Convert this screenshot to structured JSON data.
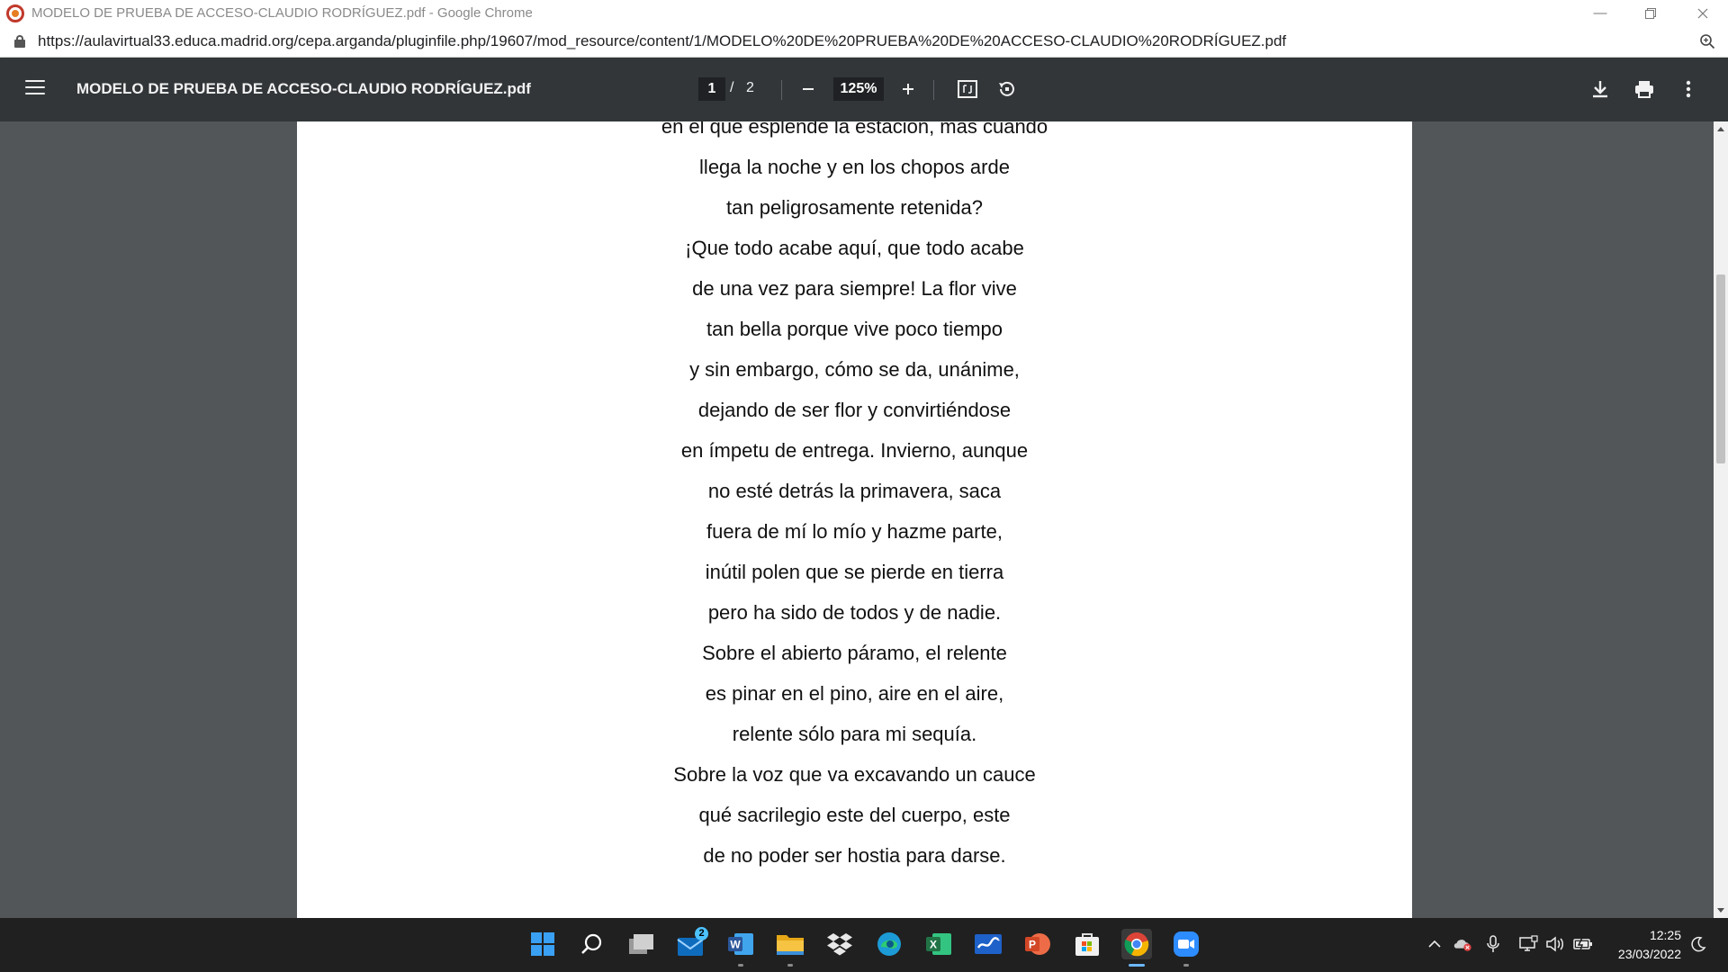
{
  "window": {
    "title": "MODELO DE PRUEBA DE ACCESO-CLAUDIO RODRÍGUEZ.pdf - Google Chrome"
  },
  "address_bar": {
    "url": "https://aulavirtual33.educa.madrid.org/cepa.arganda/pluginfile.php/19607/mod_resource/content/1/MODELO%20DE%20PRUEBA%20DE%20ACCESO-CLAUDIO%20RODRÍGUEZ.pdf"
  },
  "pdf_toolbar": {
    "title": "MODELO DE PRUEBA DE ACCESO-CLAUDIO RODRÍGUEZ.pdf",
    "current_page": "1",
    "separator": "/",
    "total_pages": "2",
    "zoom": "125%"
  },
  "document": {
    "lines": [
      "en el que esplende la estación, más cuando",
      "llega la noche y en los chopos arde",
      "tan peligrosamente retenida?",
      "¡Que todo acabe aquí, que todo acabe",
      "de una vez para siempre! La flor vive",
      "tan bella porque vive poco tiempo",
      "y sin embargo, cómo se da, unánime,",
      "dejando de ser flor y convirtiéndose",
      "en ímpetu de entrega. Invierno, aunque",
      "no esté detrás la primavera, saca",
      "fuera de mí lo mío y hazme parte,",
      "inútil polen que se pierde en tierra",
      "pero ha sido de todos y de nadie.",
      "Sobre el abierto páramo, el relente",
      "es pinar en el pino, aire en el aire,",
      "relente sólo para mi sequía.",
      "Sobre la voz que va excavando un cauce",
      "qué sacrilegio este del cuerpo, este",
      "de no poder ser hostia para darse."
    ]
  },
  "taskbar": {
    "mail_badge": "2",
    "icons": [
      "windows-start-icon",
      "search-icon",
      "task-view-icon",
      "mail-icon",
      "word-icon",
      "file-explorer-icon",
      "dropbox-icon",
      "edge-icon",
      "excel-icon",
      "whiteboard-icon",
      "powerpoint-icon",
      "microsoft-store-icon",
      "chrome-icon",
      "zoom-icon"
    ],
    "colors": {
      "windows": "#3aa0f3",
      "word": "#2b579a",
      "excel": "#217346",
      "powerpoint": "#d24726",
      "folder": "#f6c343",
      "edge": "#1c9bd6",
      "zoom": "#2d8cff",
      "chrome_red": "#db4437",
      "chrome_yellow": "#f4b400",
      "chrome_green": "#0f9d58",
      "chrome_blue": "#4285f4"
    }
  },
  "clock": {
    "time": "12:25",
    "date": "23/03/2022"
  }
}
